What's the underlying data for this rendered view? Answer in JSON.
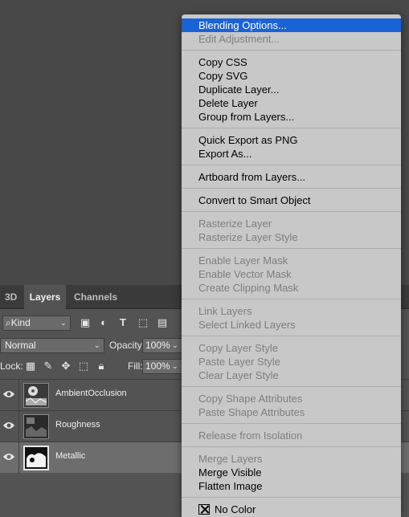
{
  "layers_panel": {
    "tabs": [
      "3D",
      "Layers",
      "Channels"
    ],
    "filter_kind": "Kind",
    "blend_mode": "Normal",
    "opacity_label": "Opacity:",
    "opacity_value": "100%",
    "lock_label": "Lock:",
    "fill_label": "Fill:",
    "fill_value": "100%",
    "layers": [
      {
        "name": "AmbientOcclusion",
        "selected": false
      },
      {
        "name": "Roughness",
        "selected": false
      },
      {
        "name": "Metallic",
        "selected": true
      }
    ]
  },
  "context_menu": {
    "groups": [
      [
        {
          "label": "Blending Options...",
          "enabled": true,
          "highlighted": true
        },
        {
          "label": "Edit Adjustment...",
          "enabled": false
        }
      ],
      [
        {
          "label": "Copy CSS",
          "enabled": true
        },
        {
          "label": "Copy SVG",
          "enabled": true
        },
        {
          "label": "Duplicate Layer...",
          "enabled": true
        },
        {
          "label": "Delete Layer",
          "enabled": true
        },
        {
          "label": "Group from Layers...",
          "enabled": true
        }
      ],
      [
        {
          "label": "Quick Export as PNG",
          "enabled": true
        },
        {
          "label": "Export As...",
          "enabled": true
        }
      ],
      [
        {
          "label": "Artboard from Layers...",
          "enabled": true
        }
      ],
      [
        {
          "label": "Convert to Smart Object",
          "enabled": true
        }
      ],
      [
        {
          "label": "Rasterize Layer",
          "enabled": false
        },
        {
          "label": "Rasterize Layer Style",
          "enabled": false
        }
      ],
      [
        {
          "label": "Enable Layer Mask",
          "enabled": false
        },
        {
          "label": "Enable Vector Mask",
          "enabled": false
        },
        {
          "label": "Create Clipping Mask",
          "enabled": false
        }
      ],
      [
        {
          "label": "Link Layers",
          "enabled": false
        },
        {
          "label": "Select Linked Layers",
          "enabled": false
        }
      ],
      [
        {
          "label": "Copy Layer Style",
          "enabled": false
        },
        {
          "label": "Paste Layer Style",
          "enabled": false
        },
        {
          "label": "Clear Layer Style",
          "enabled": false
        }
      ],
      [
        {
          "label": "Copy Shape Attributes",
          "enabled": false
        },
        {
          "label": "Paste Shape Attributes",
          "enabled": false
        }
      ],
      [
        {
          "label": "Release from Isolation",
          "enabled": false
        }
      ],
      [
        {
          "label": "Merge Layers",
          "enabled": false
        },
        {
          "label": "Merge Visible",
          "enabled": true
        },
        {
          "label": "Flatten Image",
          "enabled": true
        }
      ],
      [
        {
          "label": "No Color",
          "enabled": true,
          "checkbox": true
        }
      ]
    ]
  },
  "colors": {
    "highlight": "#1a63d6",
    "menu_bg": "#c8c8c8",
    "panel_bg": "#535353",
    "canvas_bg": "#484848"
  }
}
